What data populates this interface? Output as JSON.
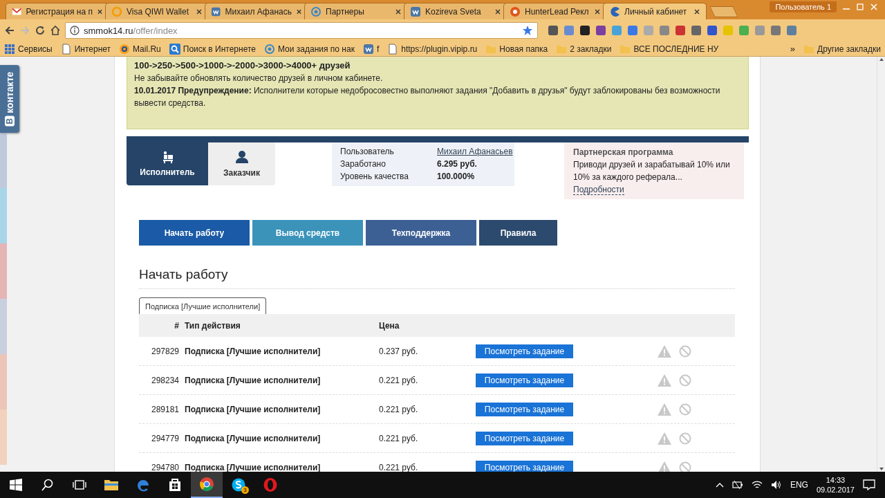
{
  "browser": {
    "tabs": [
      {
        "title": "Регистрация на п",
        "selected": false
      },
      {
        "title": "Visa QIWI Wallet",
        "selected": false
      },
      {
        "title": "Михаил Афанась",
        "selected": false
      },
      {
        "title": "Партнеры",
        "selected": false
      },
      {
        "title": "Kozireva Sveta",
        "selected": false
      },
      {
        "title": "HunterLead Рекл",
        "selected": false
      },
      {
        "title": "Личный кабинет",
        "selected": true
      }
    ],
    "profile": "Пользователь 1",
    "address": {
      "host": "smmok14.ru",
      "path": "/offer/index"
    },
    "bookmarks": [
      {
        "label": "Сервисы"
      },
      {
        "label": "Интернет"
      },
      {
        "label": "Mail.Ru"
      },
      {
        "label": "Поиск в Интернете"
      },
      {
        "label": "Мои задания по нак"
      },
      {
        "label": "f"
      },
      {
        "label": "https://plugin.vipip.ru"
      },
      {
        "label": "Новая папка"
      },
      {
        "label": "2 закладки"
      },
      {
        "label": "ВСЕ ПОСЛЕДНИЕ НУ"
      }
    ],
    "more": "»",
    "other_bookmarks": "Другие закладки"
  },
  "social": {
    "logo": "В",
    "label": "контакте"
  },
  "notice": {
    "lines": [
      {
        "text": "100->250->500->1000->-2000->3000->4000+ друзей",
        "bold": true
      },
      {
        "text": "Не забывайте обновлять количество друзей в личном кабинете.",
        "bold": false
      },
      {
        "text": "**10.01.2017 Предупреждение:** Исполнители которые недобросовестно выполняют задания \"Добавить в друзья\" будут заблокированы без возможности вывести средства.",
        "bold": false
      }
    ]
  },
  "roles": [
    {
      "label": "Исполнитель",
      "selected": true
    },
    {
      "label": "Заказчик",
      "selected": false
    }
  ],
  "account": [
    {
      "label": "Пользователь",
      "value": "Михаил Афанасьев",
      "kind": "link"
    },
    {
      "label": "Заработано",
      "value": "6.295 руб.",
      "kind": "bold"
    },
    {
      "label": "Уровень качества",
      "value": "100.000%",
      "kind": "bold"
    }
  ],
  "partner": {
    "title": "Партнерская программа",
    "text": "Приводи друзей и зарабатывай 10% или 10% за каждого реферала...",
    "link": "Подробности"
  },
  "actions": [
    {
      "label": "Начать работу",
      "color": "#1a5aa6"
    },
    {
      "label": "Вывод средств",
      "color": "#3b93ba"
    },
    {
      "label": "Техподдержка",
      "color": "#3c6094"
    },
    {
      "label": "Правила",
      "color": "#2b4a6d"
    }
  ],
  "section_title": "Начать работу",
  "task_tab": "Подписка [Лучшие исполнители]",
  "table": {
    "columns": [
      "#",
      "Тип действия",
      "Цена"
    ],
    "rows": [
      {
        "id": "297829",
        "type": "Подписка [Лучшие исполнители]",
        "price": "0.237 руб.",
        "button": "Посмотреть задание"
      },
      {
        "id": "298234",
        "type": "Подписка [Лучшие исполнители]",
        "price": "0.221 руб.",
        "button": "Посмотреть задание"
      },
      {
        "id": "289181",
        "type": "Подписка [Лучшие исполнители]",
        "price": "0.221 руб.",
        "button": "Посмотреть задание"
      },
      {
        "id": "294779",
        "type": "Подписка [Лучшие исполнители]",
        "price": "0.221 руб.",
        "button": "Посмотреть задание"
      },
      {
        "id": "294780",
        "type": "Подписка [Лучшие исполнители]",
        "price": "0.221 руб.",
        "button": "Посмотреть задание"
      }
    ]
  },
  "taskbar": {
    "apps": [
      {
        "selected": false
      },
      {
        "selected": false
      },
      {
        "selected": false
      },
      {
        "selected": true
      },
      {
        "selected": false,
        "badge": "3"
      },
      {
        "selected": false
      }
    ],
    "language": "ENG",
    "time": "14:33",
    "date": "09.02.2017"
  }
}
